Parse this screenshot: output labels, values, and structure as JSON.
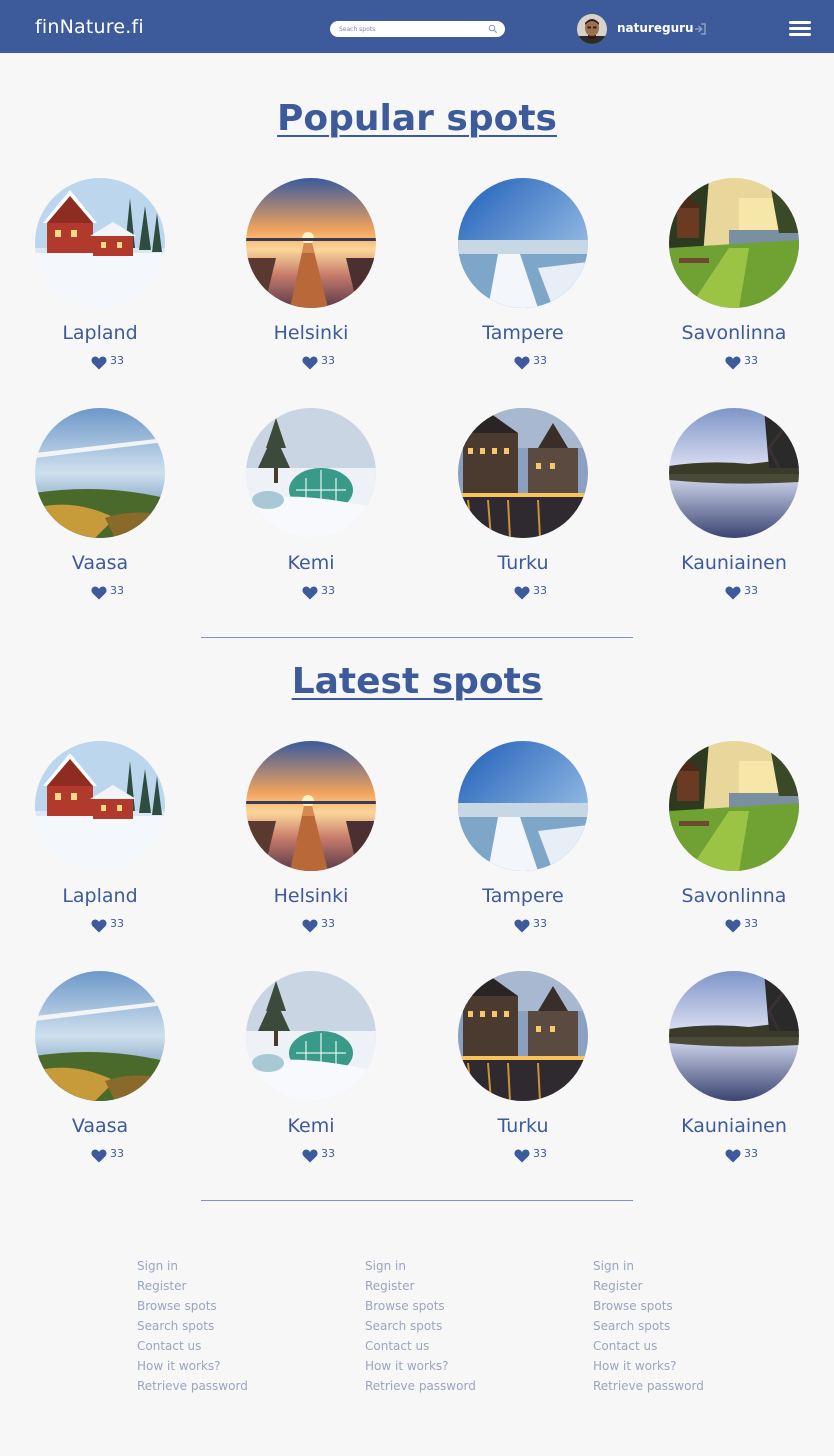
{
  "header": {
    "logo": "finNature.fi",
    "search_placeholder": "Seach spots",
    "username": "natureguru",
    "icons": [
      "search-icon",
      "logout-icon",
      "menu-icon"
    ]
  },
  "popular": {
    "title": "Popular spots",
    "spots": [
      {
        "name": "Lapland",
        "likes": "33"
      },
      {
        "name": "Helsinki",
        "likes": "33"
      },
      {
        "name": "Tampere",
        "likes": "33"
      },
      {
        "name": "Savonlinna",
        "likes": "33"
      },
      {
        "name": "Vaasa",
        "likes": "33"
      },
      {
        "name": "Kemi",
        "likes": "33"
      },
      {
        "name": "Turku",
        "likes": "33"
      },
      {
        "name": "Kauniainen",
        "likes": "33"
      }
    ]
  },
  "latest": {
    "title": "Latest spots",
    "spots": [
      {
        "name": "Lapland",
        "likes": "33"
      },
      {
        "name": "Helsinki",
        "likes": "33"
      },
      {
        "name": "Tampere",
        "likes": "33"
      },
      {
        "name": "Savonlinna",
        "likes": "33"
      },
      {
        "name": "Vaasa",
        "likes": "33"
      },
      {
        "name": "Kemi",
        "likes": "33"
      },
      {
        "name": "Turku",
        "likes": "33"
      },
      {
        "name": "Kauniainen",
        "likes": "33"
      }
    ]
  },
  "footer": {
    "columns": [
      {
        "links": [
          "Sign in",
          "Register",
          "Browse spots",
          "Search spots",
          "Contact us",
          "How it works?",
          "Retrieve password"
        ]
      },
      {
        "links": [
          "Sign in",
          "Register",
          "Browse spots",
          "Search spots",
          "Contact us",
          "How it works?",
          "Retrieve password"
        ]
      },
      {
        "links": [
          "Sign in",
          "Register",
          "Browse spots",
          "Search spots",
          "Contact us",
          "How it works?",
          "Retrieve password"
        ]
      }
    ]
  },
  "colors": {
    "brand": "#3d5a9a",
    "background": "#f7f7f8",
    "footer_link": "#9aa5c0",
    "header_text": "#ffffff"
  }
}
